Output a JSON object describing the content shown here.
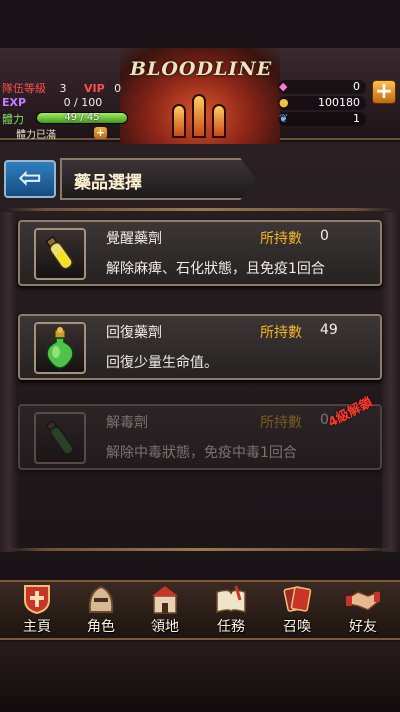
{
  "top": {
    "team_level_label": "隊伍等級",
    "team_level": "3",
    "vip_label": "VIP",
    "vip": "0",
    "exp_label": "EXP",
    "exp_value": "0 / 100",
    "stamina_label": "體力",
    "stamina_value": "49 / 45",
    "stamina_fill_fraction": 1.0,
    "stamina_full_text": "體力已滿",
    "logo_text": "BLOODLINE",
    "gems": "0",
    "gold": "100180",
    "wings": "1"
  },
  "header": {
    "back_glyph": "⇦",
    "title": "藥品選擇"
  },
  "items": [
    {
      "name": "覺醒藥劑",
      "own_label": "所持數",
      "own_value": "0",
      "desc": "解除麻痺、石化狀態，且免疫1回合",
      "icon": "yellow-potion-icon",
      "locked": false
    },
    {
      "name": "回復藥劑",
      "own_label": "所持數",
      "own_value": "49",
      "desc": "回復少量生命值。",
      "icon": "green-flask-icon",
      "locked": false
    },
    {
      "name": "解毒劑",
      "own_label": "所持數",
      "own_value": "0",
      "desc": "解除中毒狀態，免疫中毒1回合",
      "icon": "green-vial-icon",
      "locked": true,
      "unlock_text": "4級解鎖"
    }
  ],
  "nav": [
    {
      "label": "主頁",
      "icon": "home-shield-icon"
    },
    {
      "label": "角色",
      "icon": "character-helmet-icon"
    },
    {
      "label": "領地",
      "icon": "castle-icon"
    },
    {
      "label": "任務",
      "icon": "quest-book-icon"
    },
    {
      "label": "召喚",
      "icon": "summon-cards-icon"
    },
    {
      "label": "好友",
      "icon": "handshake-icon"
    }
  ],
  "colors": {
    "accent_gold": "#f2b420",
    "unlock_red": "#ff3a2a",
    "back_blue": "#2e7fc0"
  }
}
